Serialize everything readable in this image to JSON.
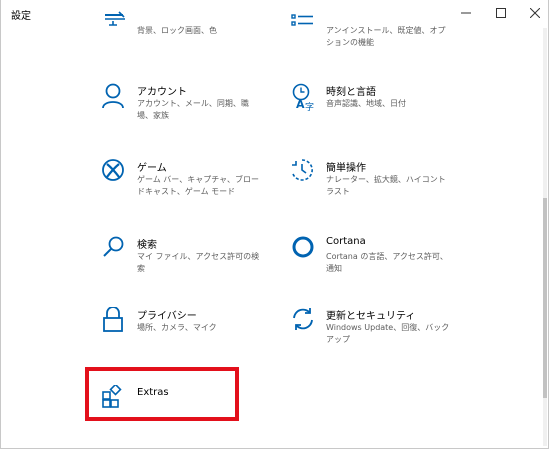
{
  "window": {
    "title": "設定"
  },
  "tiles": [
    {
      "id": "personalization",
      "name": "",
      "desc": "背景、ロック画面、色",
      "icon": "display-brush-icon"
    },
    {
      "id": "apps",
      "name": "",
      "desc": "アンインストール、既定値、オプションの機能",
      "icon": "apps-list-icon"
    },
    {
      "id": "accounts",
      "name": "アカウント",
      "desc": "アカウント、メール、同期、職場、家族",
      "icon": "person-icon"
    },
    {
      "id": "time-language",
      "name": "時刻と言語",
      "desc": "音声認識、地域、日付",
      "icon": "time-language-icon"
    },
    {
      "id": "gaming",
      "name": "ゲーム",
      "desc": "ゲーム バー、キャプチャ、ブロードキャスト、ゲーム モード",
      "icon": "xbox-icon"
    },
    {
      "id": "ease-of-access",
      "name": "簡単操作",
      "desc": "ナレーター、拡大鏡、ハイコントラスト",
      "icon": "ease-of-access-icon"
    },
    {
      "id": "search",
      "name": "検索",
      "desc": "マイ ファイル、アクセス許可の検索",
      "icon": "search-icon"
    },
    {
      "id": "cortana",
      "name": "Cortana",
      "desc": "Cortana の言語、アクセス許可、通知",
      "icon": "cortana-icon"
    },
    {
      "id": "privacy",
      "name": "プライバシー",
      "desc": "場所、カメラ、マイク",
      "icon": "lock-icon"
    },
    {
      "id": "update-security",
      "name": "更新とセキュリティ",
      "desc": "Windows Update、回復、バックアップ",
      "icon": "sync-icon"
    },
    {
      "id": "extras",
      "name": "Extras",
      "desc": "",
      "icon": "extras-icon"
    }
  ],
  "colors": {
    "accent": "#0063b1",
    "highlight": "#e3101b"
  }
}
